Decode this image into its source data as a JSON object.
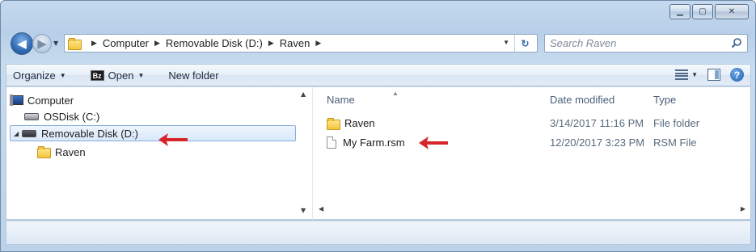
{
  "window": {
    "caption_buttons": {
      "minimize_icon": "minimize-icon",
      "maximize_icon": "maximize-icon",
      "close_icon": "close-icon"
    }
  },
  "address_bar": {
    "crumbs": [
      "Computer",
      "Removable Disk (D:)",
      "Raven"
    ]
  },
  "search": {
    "placeholder": "Search Raven"
  },
  "toolbar": {
    "organize_label": "Organize",
    "open_label": "Open",
    "open_icon_text": "Bz",
    "new_folder_label": "New folder"
  },
  "navigation_pane": {
    "items": [
      {
        "label": "Computer",
        "icon": "computer-icon"
      },
      {
        "label": "OSDisk (C:)",
        "icon": "hard-drive-icon"
      },
      {
        "label": "Removable Disk (D:)",
        "icon": "removable-drive-icon",
        "selected": true
      },
      {
        "label": "Raven",
        "icon": "folder-icon"
      }
    ]
  },
  "file_list": {
    "columns": [
      "Name",
      "Date modified",
      "Type"
    ],
    "rows": [
      {
        "name": "Raven",
        "date_modified": "3/14/2017 11:16 PM",
        "type": "File folder",
        "icon": "folder-icon"
      },
      {
        "name": "My Farm.rsm",
        "date_modified": "12/20/2017 3:23 PM",
        "type": "RSM File",
        "icon": "document-icon"
      }
    ]
  },
  "annotations": {
    "arrow_color": "#d7262b"
  },
  "colors": {
    "selection_border": "#84acdd",
    "chrome": "#c4d9ee"
  }
}
